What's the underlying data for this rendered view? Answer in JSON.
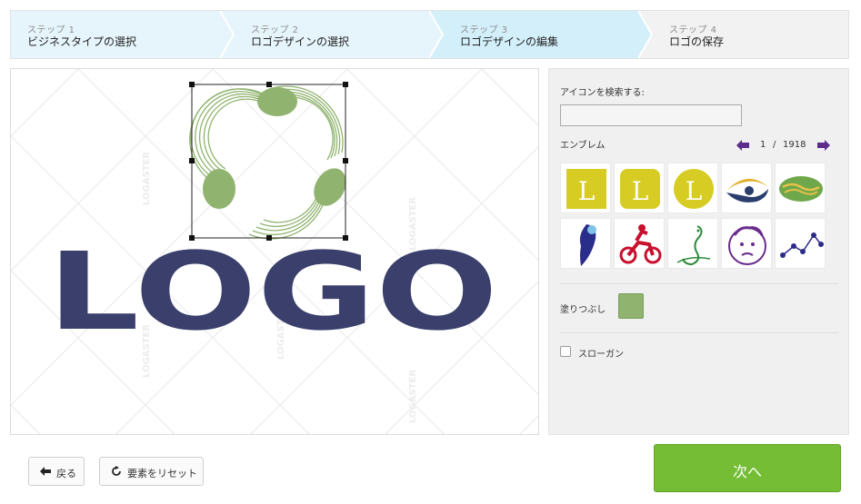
{
  "steps": [
    {
      "num": "ステップ 1",
      "title": "ビジネスタイプの選択"
    },
    {
      "num": "ステップ 2",
      "title": "ロゴデザインの選択"
    },
    {
      "num": "ステップ 3",
      "title": "ロゴデザインの編集"
    },
    {
      "num": "ステップ 4",
      "title": "ロゴの保存"
    }
  ],
  "canvas": {
    "logo_text": "LOGO",
    "watermark": "LOGASTER",
    "logo_text_color": "#3a3f6b",
    "emblem_color": "#90b36f"
  },
  "panel": {
    "search_label": "アイコンを検索する:",
    "search_value": "",
    "category_label": "エンブレム",
    "page_current": "1",
    "page_separator": "/",
    "page_total": "1918",
    "fill_label": "塗りつぶし",
    "fill_color": "#90b36f",
    "slogan_label": "スローガン",
    "slogan_checked": false,
    "icons": [
      {
        "name": "letter-l-square-icon"
      },
      {
        "name": "letter-l-rounded-icon"
      },
      {
        "name": "letter-l-circle-icon"
      },
      {
        "name": "eye-swoosh-icon"
      },
      {
        "name": "green-bowl-icon"
      },
      {
        "name": "blue-figure-icon"
      },
      {
        "name": "motocross-icon"
      },
      {
        "name": "seahorse-icon"
      },
      {
        "name": "boy-face-icon"
      },
      {
        "name": "constellation-icon"
      }
    ]
  },
  "footer": {
    "back_label": "戻る",
    "reset_label": "要素をリセット",
    "next_label": "次へ"
  },
  "colors": {
    "accent_green": "#74bd35",
    "step_active": "#d3effa",
    "step_done": "#e6f5fc",
    "pager_arrow": "#5b2c8c"
  }
}
